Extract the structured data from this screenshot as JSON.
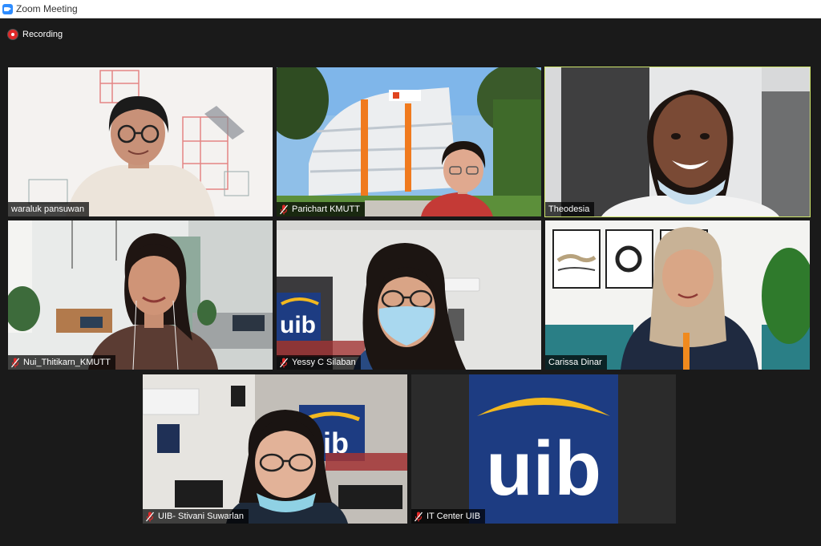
{
  "window": {
    "title": "Zoom Meeting"
  },
  "recording": {
    "label": "Recording"
  },
  "participants": [
    {
      "name": "waraluk pansuwan",
      "muted": false,
      "active": false
    },
    {
      "name": "Parichart KMUTT",
      "muted": true,
      "active": false
    },
    {
      "name": "Theodesia",
      "muted": false,
      "active": true
    },
    {
      "name": "Nui_Thitikarn_KMUTT",
      "muted": true,
      "active": false
    },
    {
      "name": "Yessy C Silaban",
      "muted": true,
      "active": false
    },
    {
      "name": "Carissa Dinar",
      "muted": false,
      "active": false
    },
    {
      "name": "UIB- Stivani Suwarlan",
      "muted": true,
      "active": false
    },
    {
      "name": "IT Center UIB",
      "muted": true,
      "active": false
    }
  ],
  "logo": {
    "text": "uib",
    "background": "#1d3c82",
    "arc_color": "#f2b81f"
  },
  "colors": {
    "active_speaker": "#cfe66b",
    "recording": "#e02828",
    "mute": "#e02828"
  }
}
